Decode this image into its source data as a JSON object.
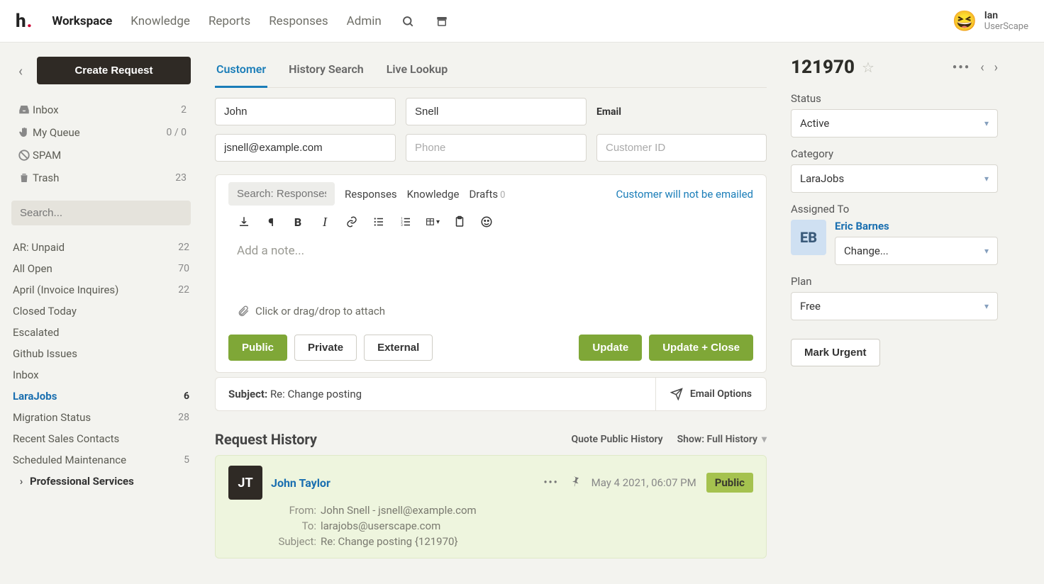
{
  "brand": {
    "letter": "h",
    "dot": "."
  },
  "topnav": {
    "items": [
      "Workspace",
      "Knowledge",
      "Reports",
      "Responses",
      "Admin"
    ],
    "active": "Workspace"
  },
  "user": {
    "name": "Ian",
    "org": "UserScape",
    "emoji": "😆"
  },
  "sidebar": {
    "create": "Create Request",
    "primary": [
      {
        "icon": "inbox",
        "label": "Inbox",
        "count": "2"
      },
      {
        "icon": "hand",
        "label": "My Queue",
        "count": "0 / 0"
      },
      {
        "icon": "ban",
        "label": "SPAM",
        "count": ""
      },
      {
        "icon": "trash",
        "label": "Trash",
        "count": "23"
      }
    ],
    "search_placeholder": "Search...",
    "filters": [
      {
        "label": "AR: Unpaid",
        "count": "22"
      },
      {
        "label": "All Open",
        "count": "70"
      },
      {
        "label": "April (Invoice Inquires)",
        "count": "22"
      },
      {
        "label": "Closed Today",
        "count": ""
      },
      {
        "label": "Escalated",
        "count": ""
      },
      {
        "label": "Github Issues",
        "count": ""
      },
      {
        "label": "Inbox",
        "count": ""
      },
      {
        "label": "LaraJobs",
        "count": "6",
        "active": true
      },
      {
        "label": "Migration Status",
        "count": "28"
      },
      {
        "label": "Recent Sales Contacts",
        "count": ""
      },
      {
        "label": "Scheduled Maintenance",
        "count": "5"
      },
      {
        "label": "Professional Services",
        "count": "",
        "bold": true,
        "chevron": true
      }
    ]
  },
  "tabs": [
    "Customer",
    "History Search",
    "Live Lookup"
  ],
  "tabs_active": "Customer",
  "customer": {
    "first": "John",
    "last": "Snell",
    "email": "jsnell@example.com",
    "phone_placeholder": "Phone",
    "cid_placeholder": "Customer ID",
    "contact_label": "Email"
  },
  "editor": {
    "search_placeholder": "Search: Responses",
    "pills": {
      "responses": "Responses",
      "knowledge": "Knowledge",
      "drafts": "Drafts",
      "drafts_count": "0"
    },
    "notice": "Customer will not be emailed",
    "placeholder": "Add a note...",
    "attach": "Click or drag/drop to attach",
    "public": "Public",
    "private": "Private",
    "external": "External",
    "update": "Update",
    "update_close": "Update + Close"
  },
  "subject": {
    "prefix": "Subject:",
    "text": "Re: Change posting",
    "email_options": "Email Options"
  },
  "history": {
    "title": "Request History",
    "quote": "Quote Public History",
    "show": "Show: Full History"
  },
  "entry": {
    "initials": "JT",
    "author": "John Taylor",
    "time": "May 4 2021, 06:07 PM",
    "badge": "Public",
    "from_label": "From:",
    "from": "John Snell - jsnell@example.com",
    "to_label": "To:",
    "to": "larajobs@userscape.com",
    "subj_label": "Subject:",
    "subj": "Re: Change posting {121970}"
  },
  "right": {
    "id": "121970",
    "status_label": "Status",
    "status": "Active",
    "category_label": "Category",
    "category": "LaraJobs",
    "assigned_label": "Assigned To",
    "assignee": "Eric Barnes",
    "assignee_initials": "EB",
    "change": "Change...",
    "plan_label": "Plan",
    "plan": "Free",
    "urgent": "Mark Urgent"
  }
}
